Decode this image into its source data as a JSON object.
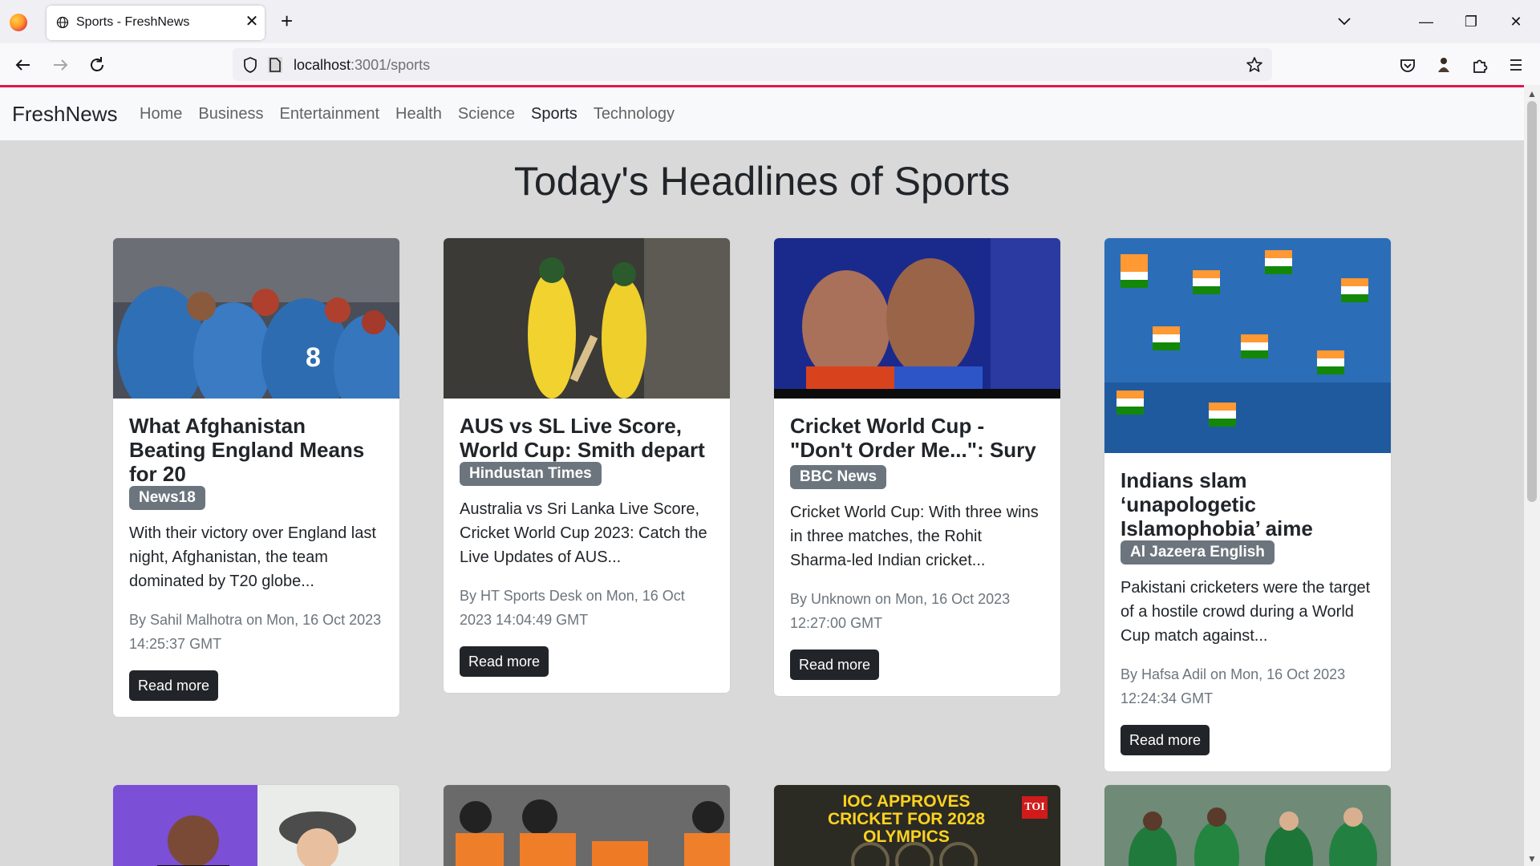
{
  "browser": {
    "tab_title": "Sports - FreshNews",
    "url_host": "localhost",
    "url_path": ":3001/sports"
  },
  "app": {
    "brand": "FreshNews",
    "nav": [
      {
        "label": "Home"
      },
      {
        "label": "Business"
      },
      {
        "label": "Entertainment"
      },
      {
        "label": "Health"
      },
      {
        "label": "Science"
      },
      {
        "label": "Sports"
      },
      {
        "label": "Technology"
      }
    ],
    "active_nav": "Sports",
    "heading": "Today's Headlines of Sports"
  },
  "articles": [
    {
      "title": "What Afghanistan Beating England Means for 20",
      "source": "News18",
      "description": "With their victory over England last night, Afghanistan, the team dominated by T20 globe...",
      "byline": "By Sahil Malhotra on Mon, 16 Oct 2023 14:25:37 GMT",
      "button": "Read more"
    },
    {
      "title": "AUS vs SL Live Score, World Cup: Smith depart",
      "source": "Hindustan Times",
      "description": "Australia vs Sri Lanka Live Score, Cricket World Cup 2023: Catch the Live Updates of AUS...",
      "byline": "By HT Sports Desk on Mon, 16 Oct 2023 14:04:49 GMT",
      "button": "Read more"
    },
    {
      "title": "Cricket World Cup - \"Don't Order Me...\": Sury",
      "source": "BBC News",
      "description": "Cricket World Cup: With three wins in three matches, the Rohit Sharma-led Indian cricket...",
      "byline": "By Unknown on Mon, 16 Oct 2023 12:27:00 GMT",
      "button": "Read more"
    },
    {
      "title": "Indians slam ‘unapologetic Islamophobia’ aime",
      "source": "Al Jazeera English",
      "description": "Pakistani cricketers were the target of a hostile crowd during a World Cup match against...",
      "byline": "By Hafsa Adil on Mon, 16 Oct 2023 12:24:34 GMT",
      "button": "Read more"
    }
  ],
  "second_row_image_texts": {
    "olympics_headline": "IOC APPROVES CRICKET FOR 2028 OLYMPICS",
    "olympics_badge": "TOI"
  },
  "colors": {
    "accent_line": "#e0174b",
    "badge_bg": "#6c757d",
    "button_bg": "#212529"
  }
}
